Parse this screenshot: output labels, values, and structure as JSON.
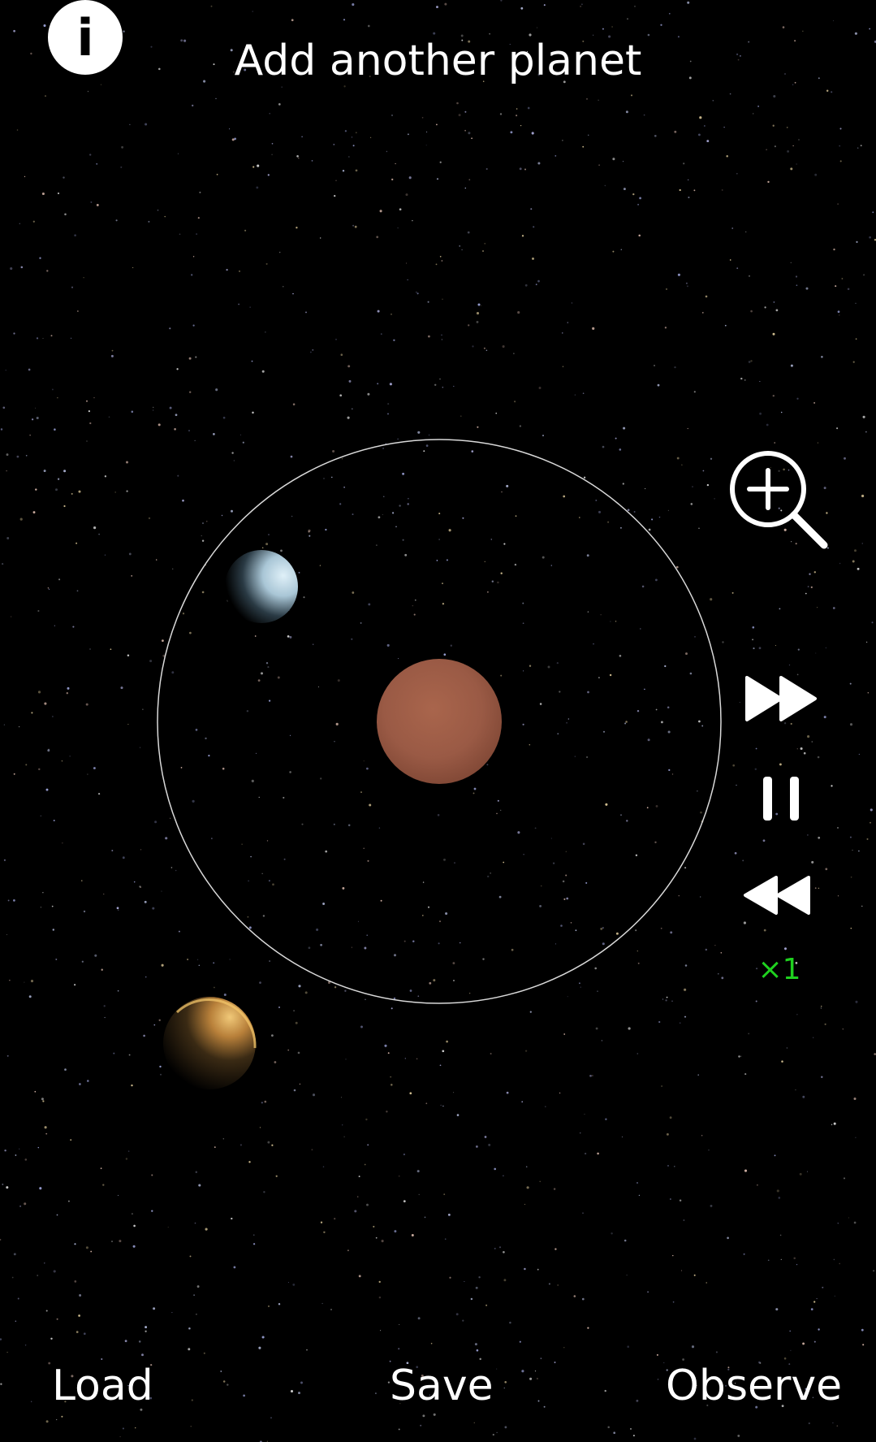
{
  "header": {
    "info_glyph": "i",
    "title": "Add another planet"
  },
  "icons": {
    "info": "info-icon",
    "zoom": "zoom-in-icon",
    "fast_forward": "fast-forward-icon",
    "pause": "pause-icon",
    "rewind": "rewind-icon"
  },
  "simulation": {
    "speed_label": "×1",
    "bodies": [
      "star",
      "planet",
      "planet"
    ]
  },
  "bottom_bar": {
    "load": "Load",
    "save": "Save",
    "observe": "Observe"
  },
  "colors": {
    "background": "#000000",
    "text": "#ffffff",
    "speed_label": "#1fd11f",
    "star": "#9a5a45",
    "orbit": "#ffffff",
    "ice_planet": "#b9d6e6",
    "gas_planet": "#d7a045"
  }
}
